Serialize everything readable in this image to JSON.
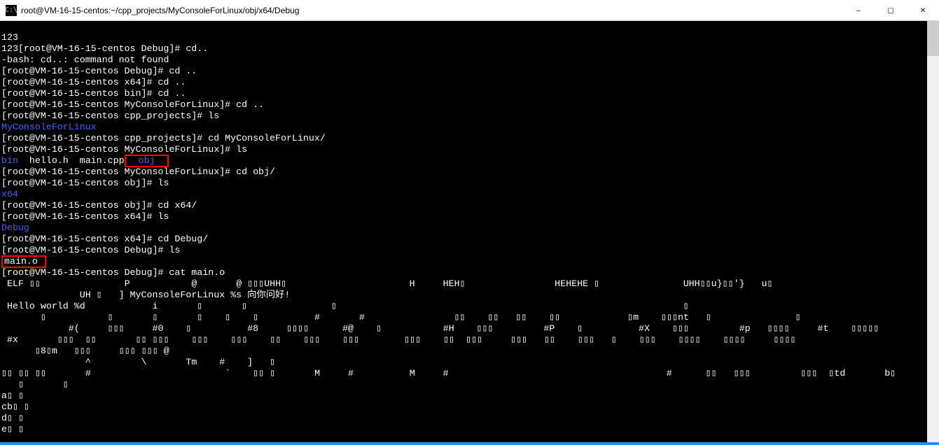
{
  "window": {
    "icon_label": "cmd-icon",
    "title": "root@VM-16-15-centos:~/cpp_projects/MyConsoleForLinux/obj/x64/Debug",
    "min_label": "–",
    "max_label": "▢",
    "close_label": "✕"
  },
  "colors": {
    "terminal_bg": "#000000",
    "terminal_fg": "#ffffff",
    "dir_blue": "#3465ff",
    "dir_blue2": "#5555ff",
    "highlight_border": "#ff0000"
  },
  "terminal": {
    "lines": {
      "l00": "123",
      "l01": "123[root@VM-16-15-centos Debug]# cd..",
      "l02": "-bash: cd..: command not found",
      "l03": "[root@VM-16-15-centos Debug]# cd ..",
      "l04": "[root@VM-16-15-centos x64]# cd ..",
      "l05": "[root@VM-16-15-centos bin]# cd ..",
      "l06": "[root@VM-16-15-centos MyConsoleForLinux]# cd ..",
      "l07": "[root@VM-16-15-centos cpp_projects]# ls",
      "l08_dir": "MyConsoleForLinux",
      "l09": "[root@VM-16-15-centos cpp_projects]# cd MyConsoleForLinux/",
      "l10": "[root@VM-16-15-centos MyConsoleForLinux]# ls",
      "l11_bin": "bin",
      "l11_files": "  hello.h  main.cpp",
      "l11_obj": "  obj  ",
      "l12": "[root@VM-16-15-centos MyConsoleForLinux]# cd obj/",
      "l13": "[root@VM-16-15-centos obj]# ls",
      "l14_dir": "x64",
      "l15": "[root@VM-16-15-centos obj]# cd x64/",
      "l16": "[root@VM-16-15-centos x64]# ls",
      "l17_dir": "Debug",
      "l18": "[root@VM-16-15-centos x64]# cd Debug/",
      "l19": "[root@VM-16-15-centos Debug]# ls",
      "l20_hl": "main.o ",
      "l21": "[root@VM-16-15-centos Debug]# cat main.o",
      "l22": " ELF ▯▯               P           @       @ ▯▯▯UHH▯                      H     HEH▯                HEHEHE ▯               UHH▯▯u}▯▯'}   u▯",
      "l23": "              UH ▯   ] MyConsoleForLinux %s 向你问好!",
      "l24": " Hello world %d            i       ▯       ▯               ▯                                                              ▯",
      "l25": "       ▯           ▯       ▯       ▯    ▯    ▯          #       #                ▯▯    ▯▯   ▯▯    ▯▯            ▯m    ▯▯▯nt   ▯               ▯",
      "l26": "            #(     ▯▯▯     #0    ▯          #8     ▯▯▯▯      #@    ▯           #H    ▯▯▯         #P    ▯          #X    ▯▯▯         #p   ▯▯▯▯     #t    ▯▯▯▯▯",
      "l27": " #x       ▯▯▯  ▯▯       ▯▯ ▯▯▯    ▯▯▯    ▯▯▯    ▯▯    ▯▯▯    ▯▯▯        ▯▯▯    ▯▯  ▯▯▯     ▯▯▯   ▯▯    ▯▯▯   ▯    ▯▯▯    ▯▯▯▯    ▯▯▯▯     ▯▯▯▯",
      "l28": "      ▯8▯m   ▯▯▯     ▯▯▯ ▯▯▯ @",
      "l29": "               ^         \\       Tm    #    ]   ▯",
      "l30": "▯▯ ▯▯ ▯▯       #                        `    ▯▯ ▯       M     #          M     #                                       #      ▯▯   ▯▯▯         ▯▯▯  ▯td       b▯",
      "l31": "   ▯       ▯",
      "l32": "a▯ ▯",
      "l33": "cb▯ ▯",
      "l34": "d▯ ▯",
      "l35": "e▯ ▯"
    }
  }
}
